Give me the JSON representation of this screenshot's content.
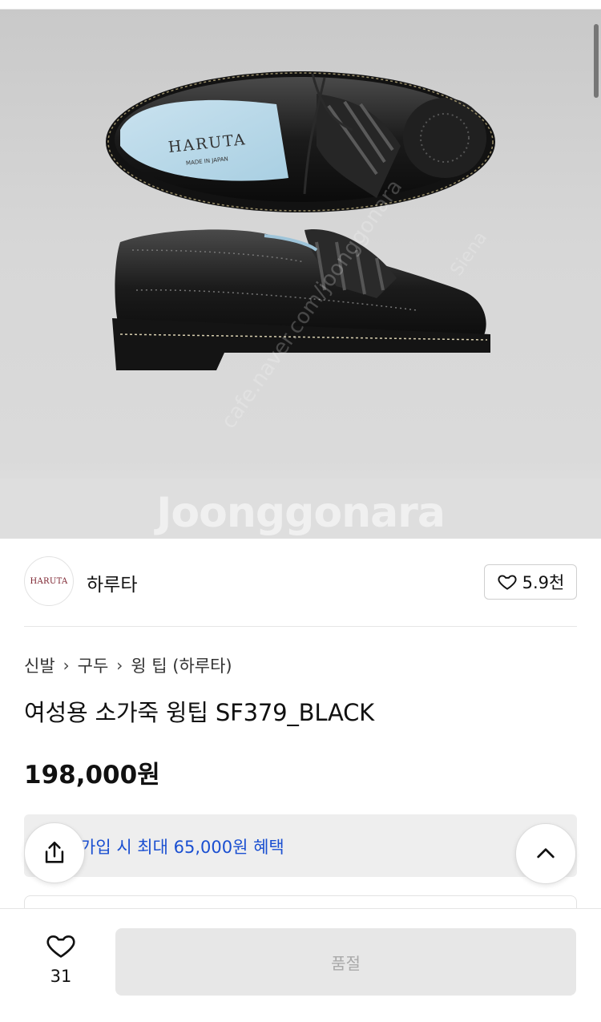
{
  "watermark": "Joonggonara",
  "product_image": {
    "brand_on_insole": "HARUTA",
    "insole_sub": "MADE IN JAPAN",
    "overlay_text": [
      "cafe.naver.com/joonggonara",
      "Siena"
    ]
  },
  "seller": {
    "logo_text": "HARUTA",
    "name": "하루타",
    "likes": "5.9천"
  },
  "breadcrumb": [
    "신발",
    "구두",
    "윙 팁 (하루타)"
  ],
  "product": {
    "title": "여성용 소가죽 윙팁 SF379_BLACK",
    "price": "198,000원"
  },
  "benefit": {
    "text": "가입 시 최대 65,000원 혜택"
  },
  "bottom": {
    "wish_count": "31",
    "action_label": "품절"
  },
  "colors": {
    "accent_blue": "#1a4fd1",
    "disabled_bg": "#e7e7e7",
    "disabled_text": "#a9a9a9",
    "brand_red": "#7a1f2b"
  },
  "icons": {
    "share": "share-icon",
    "up": "chevron-up-icon",
    "heart": "heart-icon",
    "separator": "chevron-right-icon"
  }
}
